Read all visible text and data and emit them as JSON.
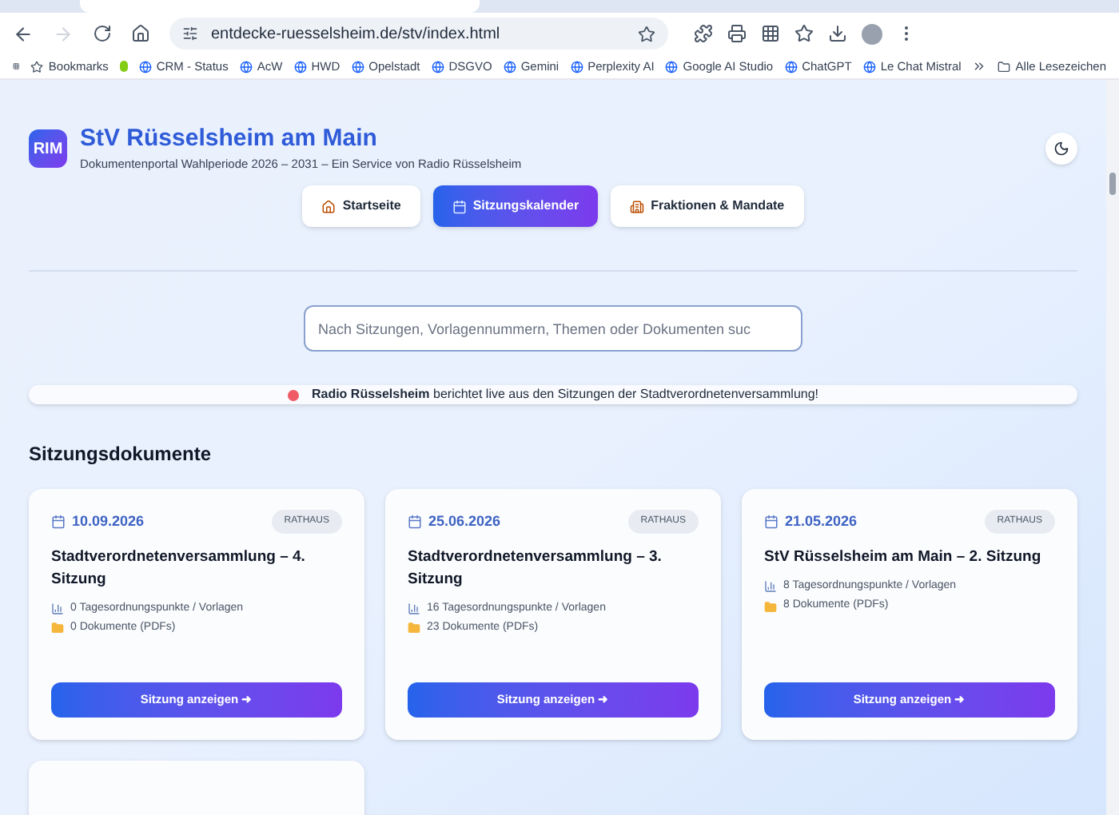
{
  "browser": {
    "url": "entdecke-ruesselsheim.de/stv/index.html",
    "bookmarks": [
      "Bookmarks",
      "CRM - Status",
      "AcW",
      "HWD",
      "Opelstadt",
      "DSGVO",
      "Gemini",
      "Perplexity AI",
      "Google AI Studio",
      "ChatGPT",
      "Le Chat Mistral"
    ],
    "all_bookmarks": "Alle Lesezeichen"
  },
  "header": {
    "logo": "RIM",
    "title": "StV Rüsselsheim am Main",
    "subtitle": "Dokumentenportal Wahlperiode 2026 – 2031 – Ein Service von Radio Rüsselsheim"
  },
  "nav": [
    {
      "label": "Startseite",
      "selected": false,
      "kind": "home"
    },
    {
      "label": "Sitzungskalender",
      "selected": true,
      "kind": "calendar"
    },
    {
      "label": "Fraktionen & Mandate",
      "selected": false,
      "kind": "building"
    }
  ],
  "search": {
    "placeholder": "Nach Sitzungen, Vorlagennummern, Themen oder Dokumenten suc"
  },
  "banner": {
    "text": "**Radio Rüsselsheim** berichtet live aus den Sitzungen der Stadtverordnetenversammlung!"
  },
  "section_title": "Sitzungsdokumente",
  "meetings": [
    {
      "date": "10.09.2026",
      "badge": "RATHAUS",
      "title": "Stadtverordnetenversammlung – 4. Sitzung",
      "agenda": "0 Tagesordnungspunkte / Vorlagen",
      "documents": "0 Dokumente (PDFs)",
      "button": "Sitzung anzeigen ➜"
    },
    {
      "date": "25.06.2026",
      "badge": "RATHAUS",
      "title": "Stadtverordnetenversammlung – 3. Sitzung",
      "agenda": "16 Tagesordnungspunkte / Vorlagen",
      "documents": "23 Dokumente (PDFs)",
      "button": "Sitzung anzeigen ➜"
    },
    {
      "date": "21.05.2026",
      "badge": "RATHAUS",
      "title": "StV Rüsselsheim am Main – 2. Sitzung",
      "agenda": "8 Tagesordnungspunkte / Vorlagen",
      "documents": "8 Dokumente (PDFs)",
      "button": "Sitzung anzeigen ➜"
    }
  ]
}
